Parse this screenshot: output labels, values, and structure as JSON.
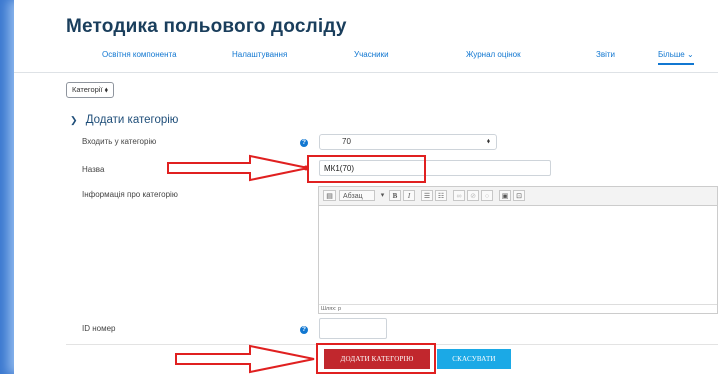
{
  "course": {
    "title": "Методика польового досліду"
  },
  "tabs": [
    {
      "label": "Освітня компонента"
    },
    {
      "label": "Налаштування"
    },
    {
      "label": "Учасники"
    },
    {
      "label": "Журнал оцінок"
    },
    {
      "label": "Звіти"
    },
    {
      "label": "Більше ⌄"
    }
  ],
  "category_select": {
    "label": "Категорії ⬧"
  },
  "section": {
    "title": "Додати категорію"
  },
  "form": {
    "parent_label": "Входить у категорію",
    "parent_value": "70",
    "name_label": "Назва",
    "name_value": "МК1(70)",
    "info_label": "Інформація про категорію",
    "id_label": "ID номер"
  },
  "editor": {
    "format": "Абзац",
    "path": "Шлях: p"
  },
  "buttons": {
    "add": "ДОДАТИ КАТЕГОРІЮ",
    "cancel": "СКАСУВАТИ"
  },
  "colors": {
    "accent_blue": "#1177d1",
    "highlight_red": "#e02020",
    "primary_button": "#c1272d",
    "cancel_button": "#1ba9e6",
    "heading": "#1a3e5c"
  }
}
